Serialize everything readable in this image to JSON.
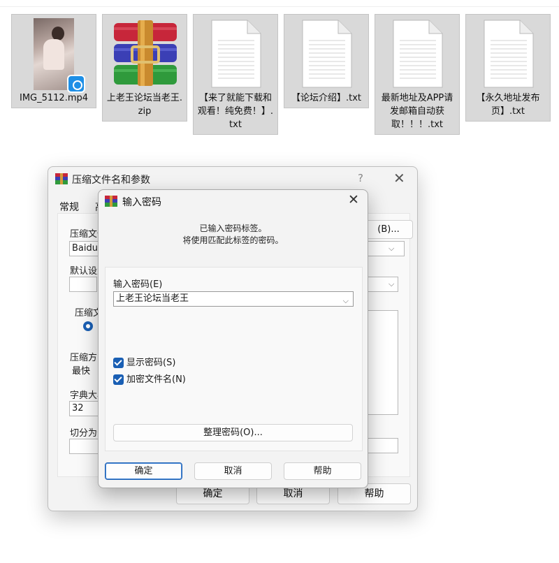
{
  "files": [
    {
      "name": "IMG_5112.mp4",
      "kind": "video"
    },
    {
      "name": "上老王论坛当老王.zip",
      "kind": "archive"
    },
    {
      "name": "【来了就能下载和观看！纯免费！】.txt",
      "kind": "text"
    },
    {
      "name": "【论坛介绍】.txt",
      "kind": "text"
    },
    {
      "name": "最新地址及APP请发邮箱自动获取！！！.txt",
      "kind": "text"
    },
    {
      "name": "【永久地址发布页】.txt",
      "kind": "text"
    }
  ],
  "back_window": {
    "title": "压缩文件名和参数",
    "help": "?",
    "close": "✕",
    "tabs": [
      "常规",
      "高"
    ],
    "archive_name_label": "压缩文件",
    "archive_name_value": "BaiduN",
    "browse_label": "(B)...",
    "default_settings_label": "默认设置",
    "format_label": "压缩文",
    "method_label": "压缩方",
    "method_value": "最快",
    "dict_label": "字典大小",
    "dict_value": "32",
    "split_label": "切分为分",
    "ok": "确定",
    "cancel": "取消",
    "help_btn": "帮助"
  },
  "password_dialog": {
    "title": "输入密码",
    "close": "✕",
    "info_line1": "已输入密码标签。",
    "info_line2": "将使用匹配此标签的密码。",
    "password_label": "输入密码(E)",
    "password_value": "上老王论坛当老王",
    "show_password": {
      "label": "显示密码(S)",
      "checked": true
    },
    "encrypt_names": {
      "label": "加密文件名(N)",
      "checked": true
    },
    "organize_button": "整理密码(O)...",
    "ok": "确定",
    "cancel": "取消",
    "help": "帮助"
  },
  "colors": {
    "accent": "#1a5fb4",
    "tile_bg": "#d9d9d9"
  }
}
